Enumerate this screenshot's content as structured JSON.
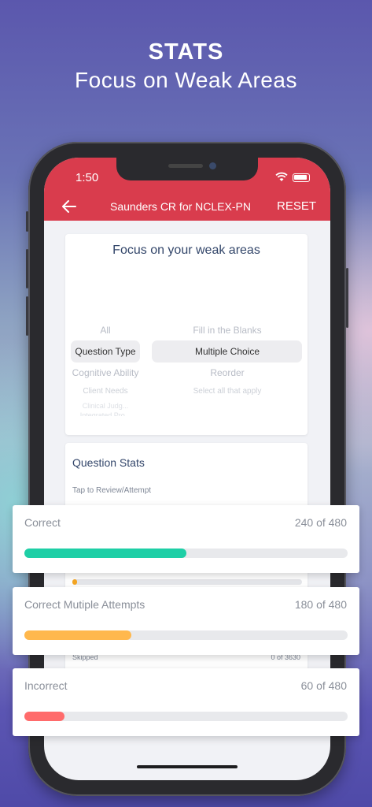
{
  "promo": {
    "title": "STATS",
    "subtitle": "Focus on Weak Areas"
  },
  "status_bar": {
    "time": "1:50",
    "wifi_icon": "wifi-icon",
    "battery_icon": "battery-icon"
  },
  "nav": {
    "back_icon": "arrow-left-icon",
    "title": "Saunders CR for NCLEX-PN",
    "reset_label": "RESET",
    "color": "#d93c4d"
  },
  "focus": {
    "title": "Focus on your weak areas",
    "left_picker": {
      "items": [
        "All",
        "Question Type",
        "Cognitive Ability",
        "Client Needs",
        "Clinical Judg...",
        "Integrated Pro..."
      ],
      "selected": "Question Type"
    },
    "right_picker": {
      "items": [
        "Fill in the Blanks",
        "Multiple Choice",
        "Reorder",
        "Select all that apply"
      ],
      "selected": "Multiple Choice"
    }
  },
  "question_stats": {
    "title": "Question Stats",
    "subtitle": "Tap to Review/Attempt",
    "skipped_label": "Skipped",
    "skipped_value": "0 of 3630",
    "partial_bar_fraction": 0.02
  },
  "stat_cards": [
    {
      "label": "Correct",
      "value": "240 of 480",
      "fraction": 0.5,
      "color": "#1ecfa6"
    },
    {
      "label": "Correct Mutiple Attempts",
      "value": "180 of 480",
      "fraction": 0.33,
      "color": "#ffb84d"
    },
    {
      "label": "Incorrect",
      "value": "60 of 480",
      "fraction": 0.125,
      "color": "#ff6b6b"
    }
  ]
}
